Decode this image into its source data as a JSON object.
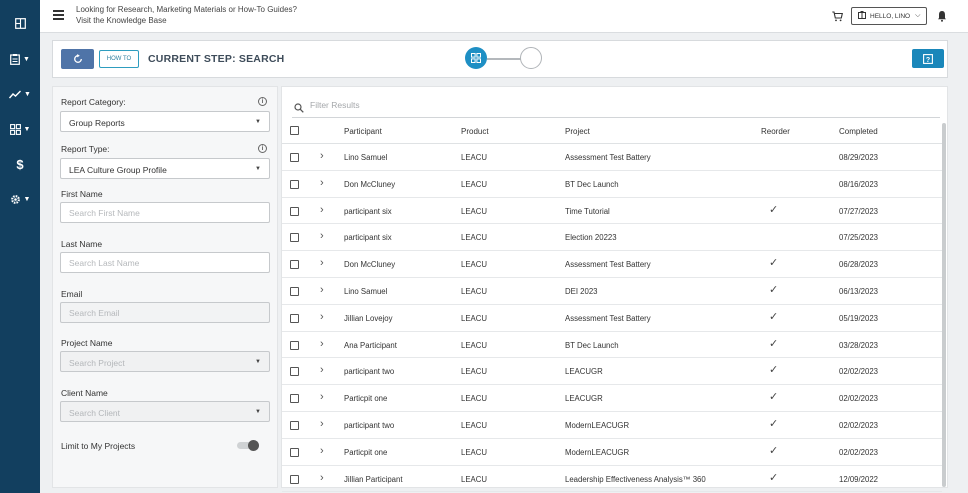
{
  "topbar": {
    "kb_line1": "Looking for Research, Marketing Materials or How-To Guides?",
    "kb_line2": "Visit the Knowledge Base",
    "hello_label": "HELLO, LINO"
  },
  "sidenav": {
    "items": [
      "dashboard-icon",
      "reports-icon",
      "analytics-icon",
      "apps-icon",
      "dollar-icon",
      "settings-icon"
    ]
  },
  "stepbar": {
    "howto_label": "HOW TO",
    "step_text": "CURRENT STEP:  SEARCH"
  },
  "filters": {
    "report_category_label": "Report Category:",
    "report_category_value": "Group Reports",
    "report_type_label": "Report Type:",
    "report_type_value": "LEA Culture Group Profile",
    "first_name_label": "First Name",
    "first_name_placeholder": "Search First Name",
    "last_name_label": "Last Name",
    "last_name_placeholder": "Search Last Name",
    "email_label": "Email",
    "email_placeholder": "Search Email",
    "project_name_label": "Project Name",
    "project_name_placeholder": "Search Project",
    "client_name_label": "Client Name",
    "client_name_placeholder": "Search Client",
    "limit_label": "Limit to My Projects"
  },
  "results": {
    "filter_placeholder": "Filter Results",
    "columns": {
      "participant": "Participant",
      "product": "Product",
      "project": "Project",
      "reorder": "Reorder",
      "completed": "Completed"
    },
    "rows": [
      {
        "participant": "Lino Samuel",
        "product": "LEACU",
        "project": "Assessment Test Battery",
        "reorder": false,
        "completed": "08/29/2023"
      },
      {
        "participant": "Don McCluney",
        "product": "LEACU",
        "project": "BT Dec Launch",
        "reorder": false,
        "completed": "08/16/2023"
      },
      {
        "participant": "participant six",
        "product": "LEACU",
        "project": "Time Tutorial",
        "reorder": true,
        "completed": "07/27/2023"
      },
      {
        "participant": "participant six",
        "product": "LEACU",
        "project": "Election 20223",
        "reorder": false,
        "completed": "07/25/2023"
      },
      {
        "participant": "Don McCluney",
        "product": "LEACU",
        "project": "Assessment Test Battery",
        "reorder": true,
        "completed": "06/28/2023"
      },
      {
        "participant": "Lino Samuel",
        "product": "LEACU",
        "project": "DEI 2023",
        "reorder": true,
        "completed": "06/13/2023"
      },
      {
        "participant": "Jillian Lovejoy",
        "product": "LEACU",
        "project": "Assessment Test Battery",
        "reorder": true,
        "completed": "05/19/2023"
      },
      {
        "participant": "Ana Participant",
        "product": "LEACU",
        "project": "BT Dec Launch",
        "reorder": true,
        "completed": "03/28/2023"
      },
      {
        "participant": "participant two",
        "product": "LEACU",
        "project": "LEACUGR",
        "reorder": true,
        "completed": "02/02/2023"
      },
      {
        "participant": "Particpit one",
        "product": "LEACU",
        "project": "LEACUGR",
        "reorder": true,
        "completed": "02/02/2023"
      },
      {
        "participant": "participant two",
        "product": "LEACU",
        "project": "ModernLEACUGR",
        "reorder": true,
        "completed": "02/02/2023"
      },
      {
        "participant": "Particpit one",
        "product": "LEACU",
        "project": "ModernLEACUGR",
        "reorder": true,
        "completed": "02/02/2023"
      },
      {
        "participant": "Jillian Participant",
        "product": "LEACU",
        "project": "Leadership Effectiveness Analysis™ 360",
        "reorder": true,
        "completed": "12/09/2022"
      }
    ]
  },
  "colors": {
    "nav_bg": "#123f5f",
    "accent": "#1a87ba",
    "refresh_bg": "#4f74a8"
  }
}
